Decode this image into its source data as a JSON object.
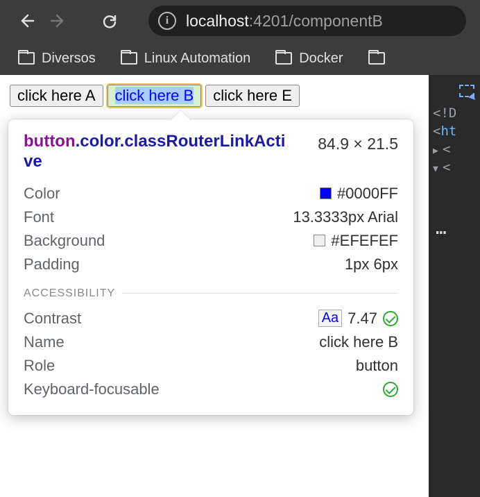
{
  "nav": {
    "url_host": "localhost",
    "url_port_path": ":4201/componentB"
  },
  "bookmarks": [
    {
      "label": "Diversos"
    },
    {
      "label": "Linux Automation"
    },
    {
      "label": "Docker"
    }
  ],
  "page": {
    "buttons": {
      "a": "click here A",
      "b": "click here B",
      "e": "click here E"
    }
  },
  "tooltip": {
    "tag": "button",
    "classes": ".color.classRouterLinkActive",
    "dimensions": "84.9 × 21.5",
    "rows": {
      "color_label": "Color",
      "color_value": "#0000FF",
      "font_label": "Font",
      "font_value": "13.3333px Arial",
      "bg_label": "Background",
      "bg_value": "#EFEFEF",
      "padding_label": "Padding",
      "padding_value": "1px 6px"
    },
    "accessibility_label": "ACCESSIBILITY",
    "a11y": {
      "contrast_label": "Contrast",
      "contrast_aa": "Aa",
      "contrast_value": "7.47",
      "name_label": "Name",
      "name_value": "click here B",
      "role_label": "Role",
      "role_value": "button",
      "kb_label": "Keyboard-focusable"
    }
  },
  "devtools": {
    "doctype": "<!D",
    "html_open": "ht",
    "more": "…"
  }
}
